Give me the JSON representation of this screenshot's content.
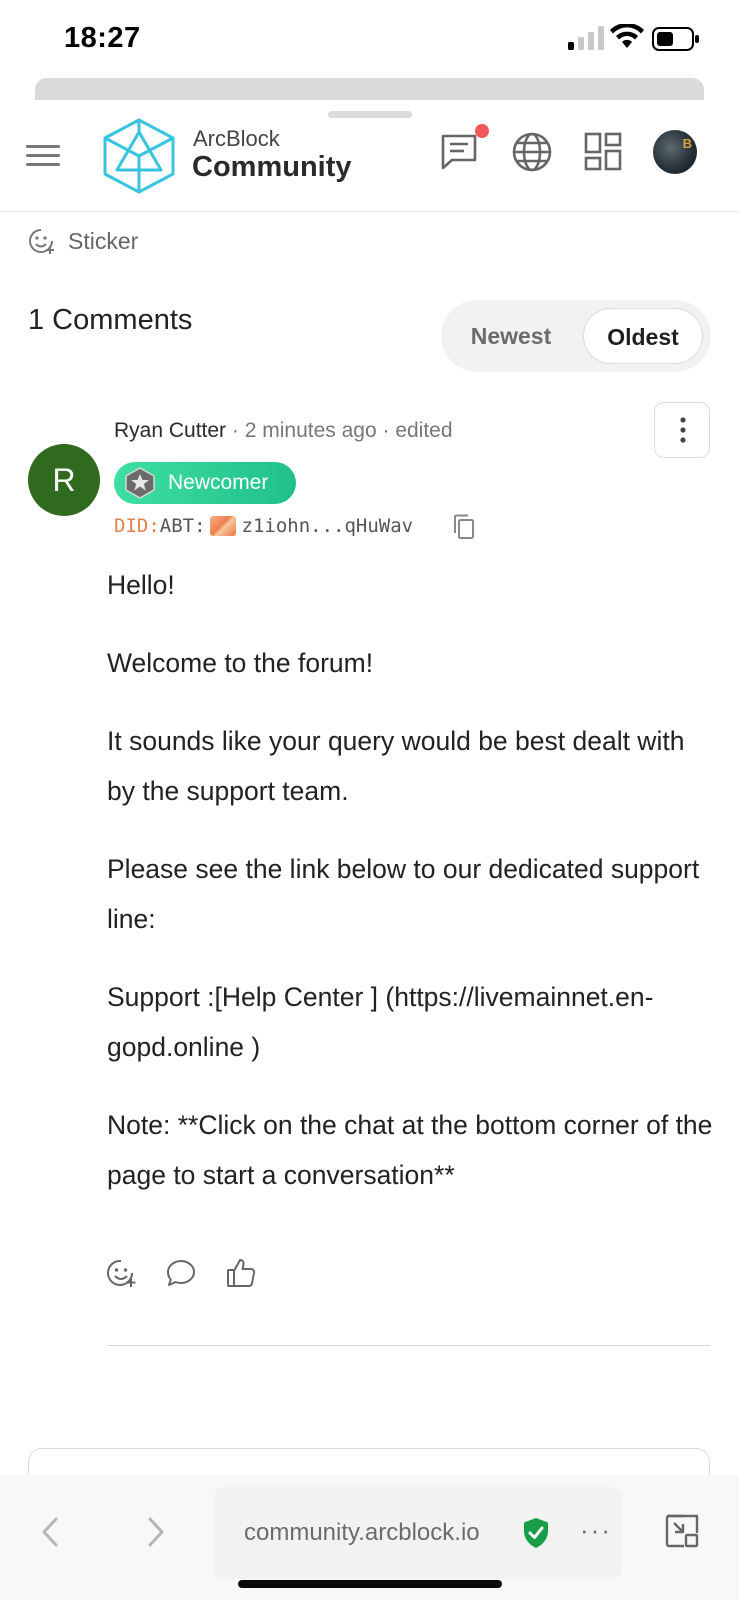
{
  "status_bar": {
    "time": "18:27"
  },
  "header": {
    "logo_line1": "ArcBlock",
    "logo_line2": "Community",
    "avatar_text": "B"
  },
  "sticker": {
    "label": "Sticker"
  },
  "comments": {
    "title": "1 Comments",
    "sort": {
      "newest": "Newest",
      "oldest": "Oldest",
      "selected": "Oldest"
    }
  },
  "comment": {
    "avatar_letter": "R",
    "author": "Ryan Cutter",
    "sep1": " · ",
    "time": "2 minutes ago",
    "sep2": " · ",
    "edited": "edited",
    "badge": "Newcomer",
    "did_prefix": "DID:",
    "did_chain": "ABT:",
    "did_address": "z1iohn...qHuWav",
    "body": [
      "Hello!",
      "Welcome to the forum!",
      "It sounds like your query would be best dealt with by the support team.",
      "Please see the link below to our dedicated support line:",
      "Support :[Help Center ] (https://livemainnet.en-gopd.online )",
      "Note: **Click on the chat at the bottom corner of the page to start a conversation**"
    ]
  },
  "browser": {
    "url": "community.arcblock.io",
    "more": "···"
  },
  "colors": {
    "accent_green": "#1fc08a",
    "avatar_green": "#2f6a1f",
    "did_orange": "#e4804a",
    "notification_red": "#f05a5a",
    "shield_green": "#1a9e4a"
  }
}
